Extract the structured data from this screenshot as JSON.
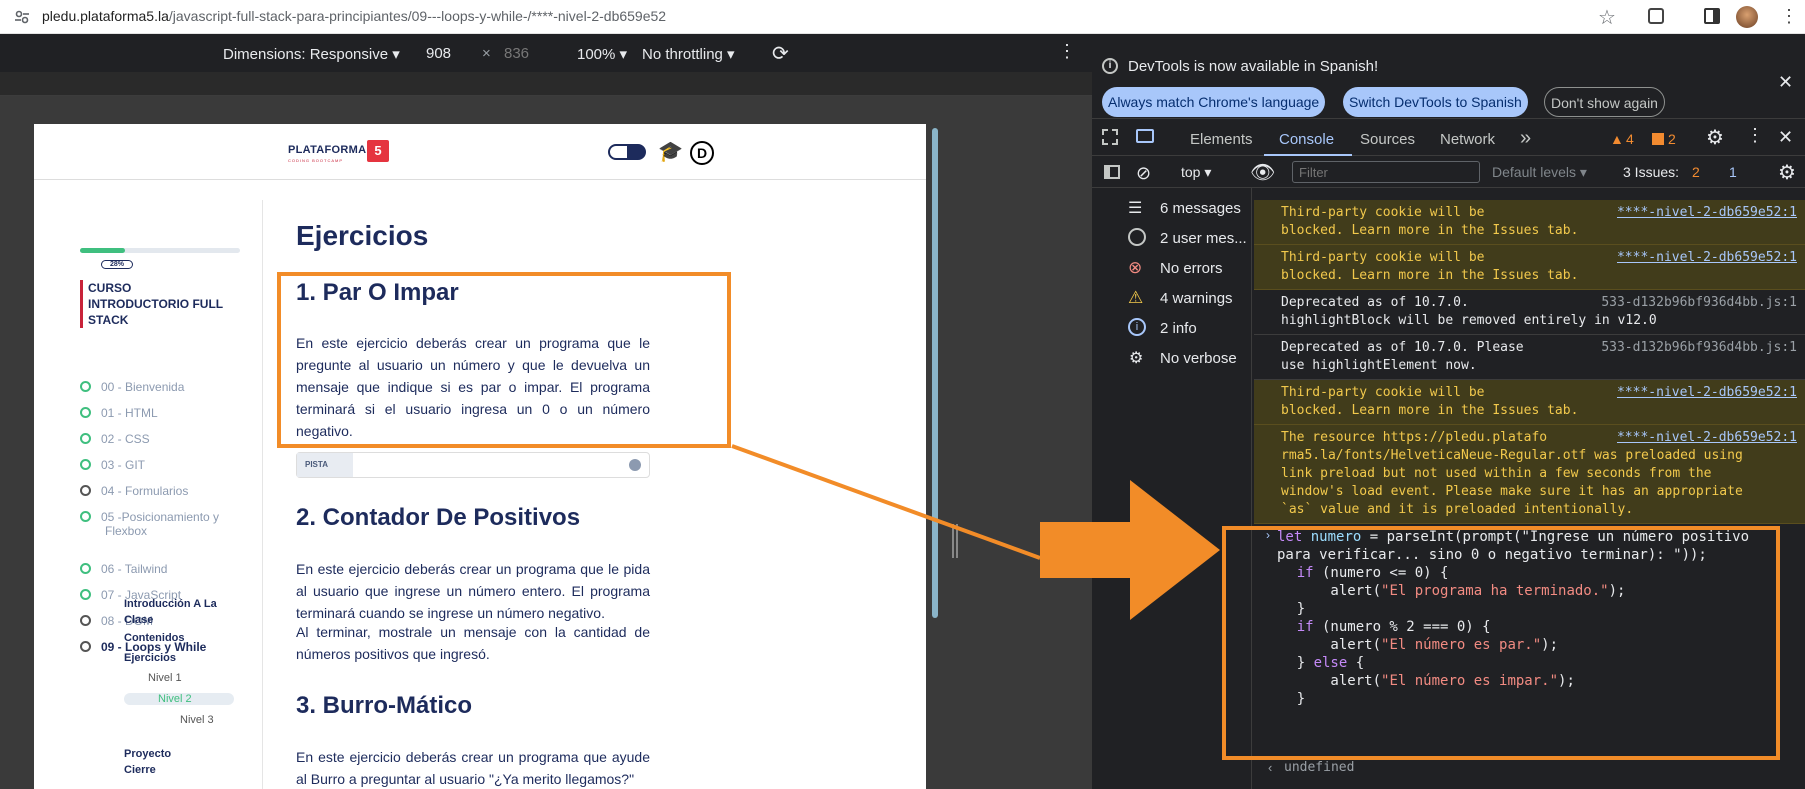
{
  "browser": {
    "url_host": "pledu.plataforma5.la",
    "url_path": "/javascript-full-stack-para-principiantes/09---loops-y-while-/****-nivel-2-db659e52"
  },
  "device_toolbar": {
    "dimensions": "Dimensions: Responsive ▾",
    "width": "908",
    "times": "×",
    "height": "836",
    "zoom": "100% ▾",
    "throttle": "No throttling ▾"
  },
  "page": {
    "logo": "PLATAFORMA",
    "logo_sub": "CODING BOOTCAMP",
    "logo_num": "5",
    "progress": "28%",
    "course_title": "CURSO INTRODUCTORIO FULL STACK",
    "sidebar": [
      {
        "label": "00 - Bienvenida",
        "done": true
      },
      {
        "label": "01 - HTML",
        "done": true
      },
      {
        "label": "02 - CSS",
        "done": true
      },
      {
        "label": "03 - GIT",
        "done": true
      },
      {
        "label": "04 - Formularios",
        "done": false
      },
      {
        "label": "05 -Posicionamiento y",
        "label2": "Flexbox",
        "done": true
      },
      {
        "label": "06 - Tailwind",
        "done": true
      },
      {
        "label": "07 - JavaScript",
        "done": true
      },
      {
        "label": "08 - DOM",
        "done": false
      },
      {
        "label": "09 - Loops y While",
        "done": false
      }
    ],
    "subitems": [
      "Introducción A La",
      "Clase",
      "Contenidos",
      "Ejercicios",
      "Proyecto",
      "Cierre"
    ],
    "niveles": [
      "Nivel 1",
      "Nivel 2",
      "Nivel 3"
    ],
    "heading": "Ejercicios",
    "ex1_title": "1. Par O Impar",
    "ex1_text": "En este ejercicio deberás crear un programa que le pregunte al usuario un número y que le devuelva un mensaje que indique si es par o impar. El programa terminará si el usuario ingresa un 0 o un número negativo.",
    "pista": "PISTA",
    "ex2_title": "2. Contador De Positivos",
    "ex2_text": "En este ejercicio deberás crear un programa que le pida al usuario que ingrese un número entero. El programa terminará cuando se ingrese un número negativo.",
    "ex2_text2": "Al terminar, mostrale un mensaje con la cantidad de números positivos que ingresó.",
    "ex3_title": "3. Burro-Mático",
    "ex3_text": "En este ejercicio deberás crear un programa que ayude al Burro a preguntar al usuario \"¿Ya merito llegamos?\""
  },
  "devtools": {
    "banner_text": "DevTools is now available in Spanish!",
    "btn_match": "Always match Chrome's language",
    "btn_switch": "Switch DevTools to Spanish",
    "btn_dont": "Don't show again",
    "tabs": [
      "Elements",
      "Console",
      "Sources",
      "Network"
    ],
    "warn_count": "4",
    "err_count": "2",
    "context": "top ▾",
    "filter_placeholder": "Filter",
    "levels": "Default levels ▾",
    "issues": "3 Issues:",
    "issues_err": "2",
    "issues_info": "1",
    "sidebar": [
      "6 messages",
      "2 user mes...",
      "No errors",
      "4 warnings",
      "2 info",
      "No verbose"
    ],
    "logs": [
      {
        "type": "warn",
        "text": "Third-party cookie will be\nblocked. Learn more in the Issues tab.",
        "src": "****-nivel-2-db659e52:1"
      },
      {
        "type": "warn",
        "text": "Third-party cookie will be\nblocked. Learn more in the Issues tab.",
        "src": "****-nivel-2-db659e52:1"
      },
      {
        "type": "plain",
        "text": "Deprecated as of 10.7.0.\nhighlightBlock will be removed entirely in v12.0",
        "src": "533-d132b96bf936d4bb.js:1"
      },
      {
        "type": "plain",
        "text": "Deprecated as of 10.7.0. Please\nuse highlightElement now.",
        "src": "533-d132b96bf936d4bb.js:1"
      },
      {
        "type": "warn",
        "text": "Third-party cookie will be\nblocked. Learn more in the Issues tab.",
        "src": "****-nivel-2-db659e52:1"
      },
      {
        "type": "warn",
        "text": "The resource https://pledu.platafo\nrma5.la/fonts/HelveticaNeue-Regular.otf was preloaded using\nlink preload but not used within a few seconds from the\nwindow's load event. Please make sure it has an appropriate\n`as` value and it is preloaded intentionally.",
        "src": "****-nivel-2-db659e52:1"
      }
    ],
    "code_lines": [
      "let numero = parseInt(prompt(\"Ingrese un número positivo",
      "para verificar... sino 0 o negativo terminar): \"));",
      "",
      "    if (numero <= 0) {",
      "        alert(\"El programa ha terminado.\");",
      "    }",
      "",
      "    if (numero % 2 === 0) {",
      "        alert(\"El número es par.\");",
      "    } else {",
      "        alert(\"El número es impar.\");",
      "    }"
    ],
    "result": "undefined"
  },
  "colors": {
    "accent_orange": "#f28c28",
    "brand_red": "#e5343f",
    "navy": "#1d2b5c"
  }
}
